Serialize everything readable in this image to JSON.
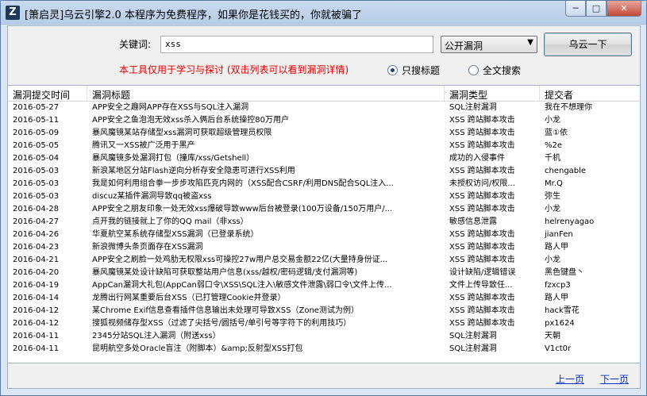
{
  "window": {
    "title": "[箫启灵]乌云引擎2.0   本程序为免费程序，如果你是花钱买的，你就被骗了",
    "app_icon_letter": "Z",
    "min_glyph": "─",
    "max_glyph": "□",
    "close_glyph": "✕"
  },
  "search": {
    "keyword_label": "关键词:",
    "keyword_value": "xss",
    "category_selected": "公开漏洞",
    "dropdown_glyph": "▼",
    "search_button": "乌云一下",
    "warning": "本工具仅用于学习与探讨   (双击列表可以看到漏洞详情)",
    "radio_title_only": "只搜标题",
    "radio_fulltext": "全文搜索"
  },
  "table": {
    "columns": [
      "漏洞提交时间",
      "漏洞标题",
      "漏洞类型",
      "提交者"
    ],
    "rows": [
      [
        "2016-05-27",
        "APP安全之趣网APP存在XSS与SQL注入漏洞",
        "SQL注射漏洞",
        "我在不想理你"
      ],
      [
        "2016-05-11",
        "APP安全之鱼泡泡无效xss杀入俩后台系统操控80万用户",
        "XSS 跨站脚本攻击",
        "小龙"
      ],
      [
        "2016-05-09",
        "暴风魔镜某站存储型xss漏洞可获取超级管理员权限",
        "XSS 跨站脚本攻击",
        "蓝①依"
      ],
      [
        "2016-05-05",
        "腾讯又一XSS被广泛用于黑产",
        "XSS 跨站脚本攻击",
        "%2e"
      ],
      [
        "2016-05-04",
        "暴风魔镜多处漏洞打包（撞库/xss/Getshell）",
        "成功的入侵事件",
        "千机"
      ],
      [
        "2016-05-03",
        "新浪某地区分站Flash逆向分析存安全隐患可进行XSS利用",
        "XSS 跨站脚本攻击",
        "chengable"
      ],
      [
        "2016-05-03",
        "我是如何利用组合拳一步步攻陷匹克内网的（XSS配合CSRF/利用DNS配合SQL注入...",
        "未授权访问/权限...",
        "Mr.Q"
      ],
      [
        "2016-05-03",
        "discuz某插件漏洞导致qq被盗xss",
        "XSS 跨站脚本攻击",
        "弥生"
      ],
      [
        "2016-04-28",
        "APP安全之朋友印象一处无效xss爆破导致www后台被登录(100万设备/150万用户/...",
        "XSS 跨站脚本攻击",
        "小龙"
      ],
      [
        "2016-04-27",
        "点开我的链接就上了你的QQ mail（非xss）",
        "敏感信息泄露",
        "helrenyagao"
      ],
      [
        "2016-04-26",
        "华夏航空某系统存储型XSS漏洞（已登录系统）",
        "XSS 跨站脚本攻击",
        "jianFen"
      ],
      [
        "2016-04-23",
        "新浪微博头条页面存在XSS漏洞",
        "XSS 跨站脚本攻击",
        "路人甲"
      ],
      [
        "2016-04-21",
        "APP安全之刷脸一处鸡肋无权限xss可操控27w用户总交易金额22亿(大量持身份证...",
        "XSS 跨站脚本攻击",
        "小龙"
      ],
      [
        "2016-04-20",
        "暴风魔镜某处设计缺陷可获取整站用户信息(xss/越权/密码逻辑/支付漏洞等)",
        "设计缺陷/逻辑错误",
        "黑色键盘丶"
      ],
      [
        "2016-04-19",
        "AppCan漏洞大礼包(AppCan弱口令\\XSS\\SQL注入\\敏感文件泄露\\弱口令\\文件上传...",
        "文件上传导致任...",
        "fzxcp3"
      ],
      [
        "2016-04-14",
        "龙腾出行网某重要后台XSS（已打管理Cookie并登录）",
        "XSS 跨站脚本攻击",
        "路人甲"
      ],
      [
        "2016-04-12",
        "某Chrome Exif信息查看插件信息输出未处理可导致XSS（Zone测试为例）",
        "XSS 跨站脚本攻击",
        "hack雪花"
      ],
      [
        "2016-04-12",
        "搜狐视频储存型XSS（过滤了尖括号/圆括号/单引号等字符下的利用技巧）",
        "XSS 跨站脚本攻击",
        "px1624"
      ],
      [
        "2016-04-11",
        "2345分站SQL注入漏洞（附送xss）",
        "SQL注射漏洞",
        "天朝"
      ],
      [
        "2016-04-11",
        "昆明航空多处Oracle盲注（附脚本）&amp;反射型XSS打包",
        "SQL注射漏洞",
        "V1ct0r"
      ]
    ]
  },
  "pager": {
    "prev": "上一页",
    "next": "下一页"
  }
}
